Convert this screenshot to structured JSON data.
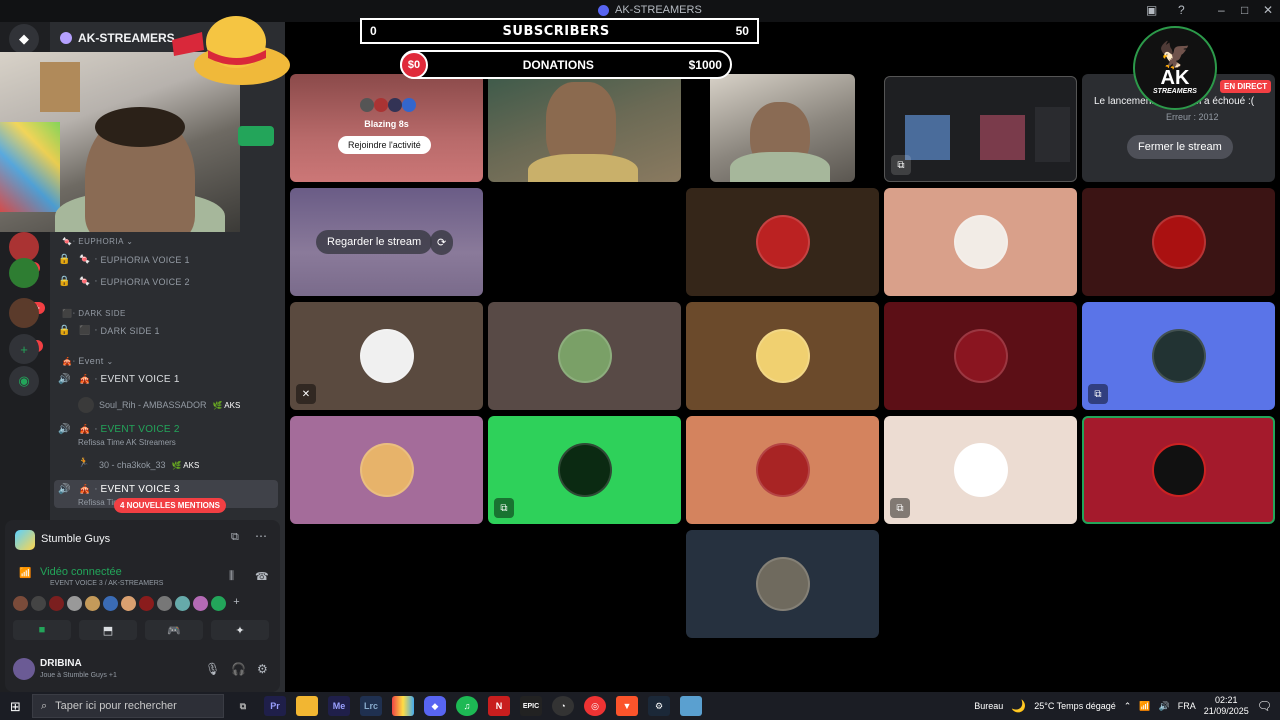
{
  "window": {
    "title": "AK-STREAMERS"
  },
  "rail": {
    "badges": [
      "85",
      "2K+",
      "163"
    ]
  },
  "guild": {
    "name": "AK-STREAMERS"
  },
  "channels": {
    "cat_euphoria": "EUPHORIA",
    "euphoria1": "EUPHORIA VOICE 1",
    "euphoria2": "EUPHORIA VOICE 2",
    "cat_dark": "DARK SIDE",
    "dark1": "DARK SIDE 1",
    "cat_event": "Event",
    "event1": "EVENT VOICE 1",
    "event1_user": "Soul_Rih - AMBASSADOR",
    "event1_tag": "AKS",
    "event2": "EVENT VOICE 2",
    "event2_status": "Refissa Time AK Streamers",
    "event2_user": "30 - cha3kok_33",
    "event2_tag": "AKS",
    "event3": "EVENT VOICE 3",
    "event3_status": "Refissa Tim",
    "mentions": "4 NOUVELLES MENTIONS"
  },
  "voice": {
    "activity": "Stumble Guys",
    "connected": "Vidéo connectée",
    "channel_path": "EVENT VOICE 3 / AK-STREAMERS"
  },
  "user": {
    "name": "DRIBINA",
    "status": "Joue à Stumble Guys +1"
  },
  "overlay": {
    "sub_left": "0",
    "sub_title": "SUBSCRIBERS",
    "sub_right": "50",
    "don_left": "$0",
    "don_title": "DONATIONS",
    "don_right": "$1000"
  },
  "tiles": {
    "activity_name": "Blazing 8s",
    "join_activity": "Rejoindre l'activité",
    "watch_stream": "Regarder le stream",
    "stream_error": "Le lancement du stream a échoué :(",
    "error_code": "Erreur : 2012",
    "close_stream": "Fermer le stream",
    "live_badge": "EN DIRECT"
  },
  "logo": {
    "brand": "AK",
    "sub": "STREAMERS"
  },
  "taskbar": {
    "search_placeholder": "Taper ici pour rechercher",
    "bureau": "Bureau",
    "weather": "25°C  Temps dégagé",
    "lang": "FRA",
    "time": "02:21",
    "date": "21/09/2025"
  },
  "colors": {
    "discord_green": "#23a55a",
    "discord_red": "#f23f43",
    "accent_blurple": "#5865f2"
  }
}
